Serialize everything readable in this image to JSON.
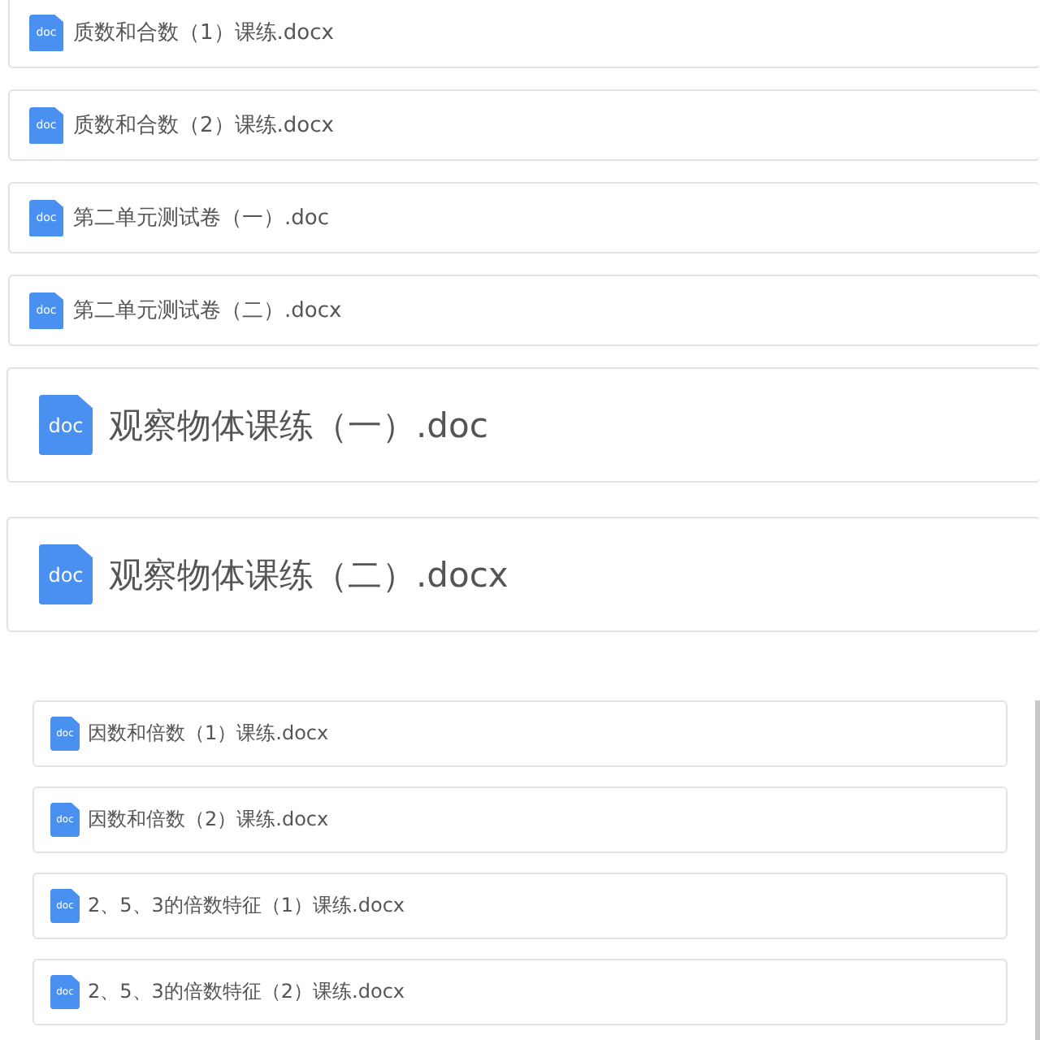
{
  "sections": [
    {
      "kind": "medium",
      "files": [
        {
          "name": "质数和合数（1）课练.docx",
          "icon_label": "doc"
        },
        {
          "name": "质数和合数（2）课练.docx",
          "icon_label": "doc"
        },
        {
          "name": "第二单元测试卷（一）.doc",
          "icon_label": "doc"
        },
        {
          "name": "第二单元测试卷（二）.docx",
          "icon_label": "doc"
        }
      ]
    },
    {
      "kind": "large",
      "files": [
        {
          "name": "观察物体课练（一）.doc",
          "icon_label": "doc"
        },
        {
          "name": "观察物体课练（二）.docx",
          "icon_label": "doc"
        }
      ]
    },
    {
      "kind": "small",
      "files": [
        {
          "name": "因数和倍数（1）课练.docx",
          "icon_label": "doc"
        },
        {
          "name": "因数和倍数（2）课练.docx",
          "icon_label": "doc"
        },
        {
          "name": "2、5、3的倍数特征（1）课练.docx",
          "icon_label": "doc"
        },
        {
          "name": "2、5、3的倍数特征（2）课练.docx",
          "icon_label": "doc"
        }
      ]
    }
  ]
}
